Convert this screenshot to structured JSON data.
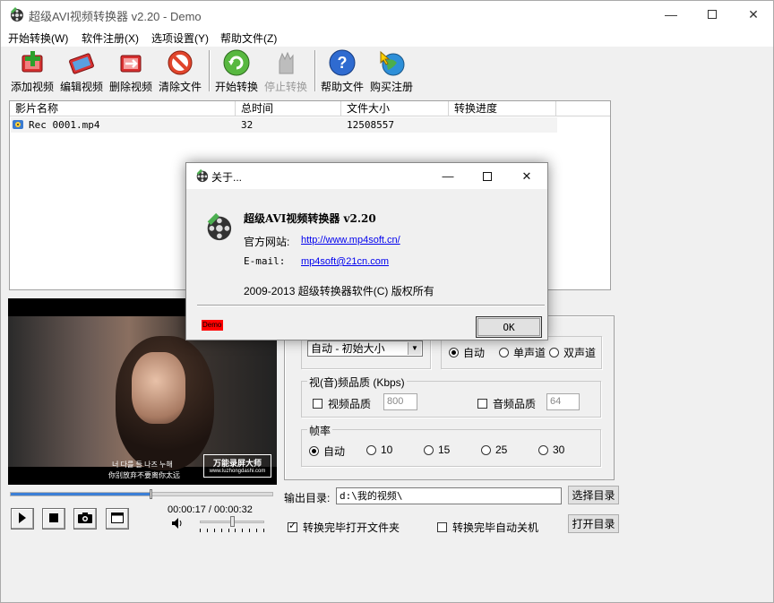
{
  "window": {
    "title": "超级AVI视频转换器 v2.20 - Demo"
  },
  "menu": [
    "开始转换(W)",
    "软件注册(X)",
    "选项设置(Y)",
    "帮助文件(Z)"
  ],
  "toolbar": {
    "add_video": "添加视频",
    "edit_video": "编辑视频",
    "delete_video": "删除视频",
    "clear_files": "清除文件",
    "start_convert": "开始转换",
    "stop_convert": "停止转换",
    "help_file": "帮助文件",
    "buy_register": "购买注册"
  },
  "filelist": {
    "columns": [
      "影片名称",
      "总时间",
      "文件大小",
      "转换进度"
    ],
    "rows": [
      {
        "name": "Rec 0001.mp4",
        "duration": "32",
        "size": "12508557",
        "progress": ""
      }
    ]
  },
  "preview": {
    "subtitle_line1": "너 다를 들 나즈 누해",
    "subtitle_line2": "你别放弃不要离你太远",
    "watermark_title": "万能录屏大师",
    "watermark_url": "www.luzhongdashi.com",
    "seek_progress": 0.53
  },
  "player": {
    "time": "00:00:17 / 00:00:32",
    "volume": 0.5
  },
  "settings": {
    "size_combo": "自动 - 初始大小",
    "channels": {
      "options": [
        "自动",
        "单声道",
        "双声道"
      ],
      "selected": "自动"
    },
    "quality": {
      "title": "视(音)频品质 (Kbps)",
      "video_label": "视频品质",
      "video_value": "800",
      "audio_label": "音频品质",
      "audio_value": "64"
    },
    "framerate": {
      "title": "帧率",
      "options": [
        "自动",
        "10",
        "15",
        "25",
        "30"
      ],
      "selected": "自动"
    }
  },
  "output": {
    "label": "输出目录:",
    "path": "d:\\我的视频\\",
    "choose_button": "选择目录",
    "open_button": "打开目录",
    "open_folder_checkbox": "转换完毕打开文件夹",
    "open_folder_checked": true,
    "shutdown_checkbox": "转换完毕自动关机",
    "shutdown_checked": false
  },
  "about": {
    "title": "关于...",
    "product": "超级AVI视频转换器 v2.20",
    "website_label": "官方网站:",
    "website": "http://www.mp4soft.cn/",
    "email_label": "E-mail:",
    "email": "mp4soft@21cn.com",
    "copyright": "2009-2013 超级转换器软件(C) 版权所有",
    "demo_badge": "Demo",
    "ok_button": "OK"
  },
  "colors": {
    "accent": "#3c7fd6",
    "demo_badge": "#ff0000",
    "link": "#0000ee"
  }
}
